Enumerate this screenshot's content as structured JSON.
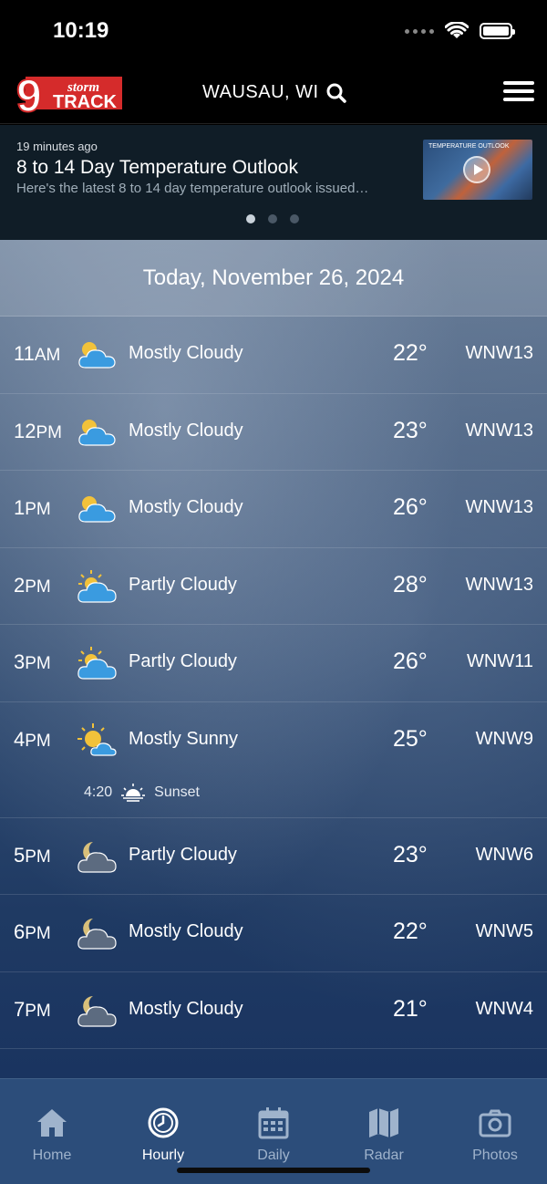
{
  "status": {
    "time": "10:19"
  },
  "header": {
    "logo_number": "9",
    "logo_top": "storm",
    "logo_bottom": "TRACK",
    "location": "WAUSAU, WI"
  },
  "news": {
    "ago": "19 minutes ago",
    "title": "8 to 14 Day Temperature Outlook",
    "subtitle": "Here's the latest 8 to 14 day temperature outlook issued…",
    "thumb_label": "TEMPERATURE OUTLOOK",
    "page_count": 3,
    "active_page": 1
  },
  "date_label": "Today, November 26, 2024",
  "hours": [
    {
      "time": "11",
      "suffix": "AM",
      "icon": "sun-cloud-icon",
      "cond": "Mostly Cloudy",
      "temp": "22°",
      "wind": "WNW13"
    },
    {
      "time": "12",
      "suffix": "PM",
      "icon": "sun-cloud-icon",
      "cond": "Mostly Cloudy",
      "temp": "23°",
      "wind": "WNW13"
    },
    {
      "time": "1",
      "suffix": "PM",
      "icon": "sun-cloud-icon",
      "cond": "Mostly Cloudy",
      "temp": "26°",
      "wind": "WNW13"
    },
    {
      "time": "2",
      "suffix": "PM",
      "icon": "partly-cloudy-icon",
      "cond": "Partly Cloudy",
      "temp": "28°",
      "wind": "WNW13"
    },
    {
      "time": "3",
      "suffix": "PM",
      "icon": "partly-cloudy-icon",
      "cond": "Partly Cloudy",
      "temp": "26°",
      "wind": "WNW11"
    },
    {
      "time": "4",
      "suffix": "PM",
      "icon": "mostly-sunny-icon",
      "cond": "Mostly Sunny",
      "temp": "25°",
      "wind": "WNW9",
      "sunset_time": "4:20",
      "sunset_label": "Sunset"
    },
    {
      "time": "5",
      "suffix": "PM",
      "icon": "moon-cloud-icon",
      "cond": "Partly Cloudy",
      "temp": "23°",
      "wind": "WNW6"
    },
    {
      "time": "6",
      "suffix": "PM",
      "icon": "moon-cloud-icon",
      "cond": "Mostly Cloudy",
      "temp": "22°",
      "wind": "WNW5"
    },
    {
      "time": "7",
      "suffix": "PM",
      "icon": "moon-cloud-icon",
      "cond": "Mostly Cloudy",
      "temp": "21°",
      "wind": "WNW4"
    }
  ],
  "tabs": [
    {
      "label": "Home",
      "icon": "home-icon"
    },
    {
      "label": "Hourly",
      "icon": "clock-icon",
      "active": true
    },
    {
      "label": "Daily",
      "icon": "calendar-icon"
    },
    {
      "label": "Radar",
      "icon": "map-icon"
    },
    {
      "label": "Photos",
      "icon": "camera-icon"
    }
  ],
  "colors": {
    "header_bg": "#000000",
    "news_bg": "#101d27",
    "tabbar_bg": "#2c4d7a",
    "logo_red": "#d52b2b",
    "sun_yellow": "#f2c23a",
    "cloud_blue": "#3a9be0"
  }
}
